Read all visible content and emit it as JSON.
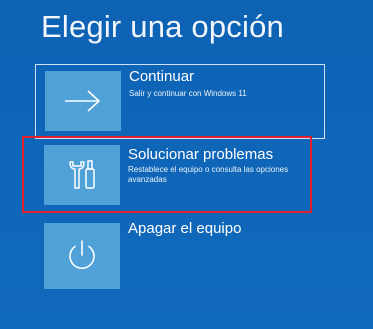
{
  "screen": {
    "title": "Elegir una opción"
  },
  "options": [
    {
      "title": "Continuar",
      "description": "Salir y continuar con Windows 11",
      "icon": "arrow-right-icon"
    },
    {
      "title": "Solucionar problemas",
      "description": "Restablece el equipo o consulta las opciones avanzadas",
      "icon": "tools-icon"
    },
    {
      "title": "Apagar el equipo",
      "description": "",
      "icon": "power-icon"
    }
  ],
  "colors": {
    "background": "#0f66b8",
    "tile": "#4fa1d8",
    "highlight": "#e0202a"
  }
}
